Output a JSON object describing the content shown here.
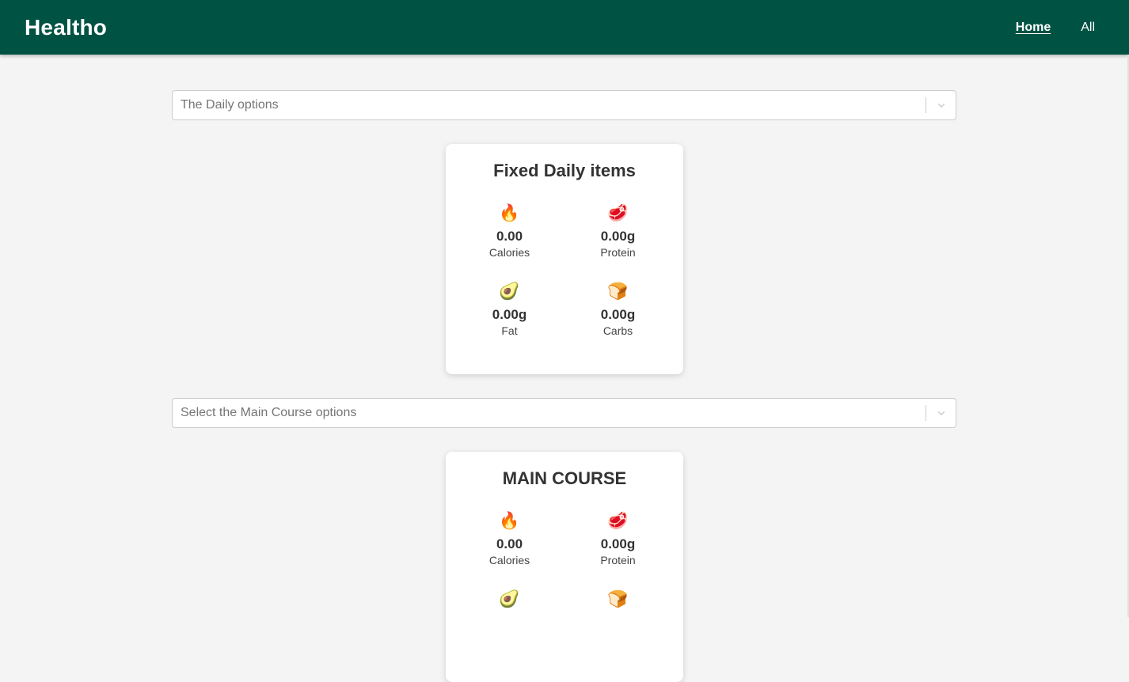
{
  "nav": {
    "brand": "Healtho",
    "links": [
      {
        "label": "Home",
        "active": true
      },
      {
        "label": "All",
        "active": false
      }
    ],
    "color": "#005243"
  },
  "daily": {
    "select_placeholder": "The Daily options",
    "card_title": "Fixed Daily items",
    "stats": [
      {
        "icon": "fire-icon",
        "emoji": "🔥",
        "value": "0.00",
        "label": "Calories"
      },
      {
        "icon": "meat-icon",
        "emoji": "🥩",
        "value": "0.00g",
        "label": "Protein"
      },
      {
        "icon": "avocado-icon",
        "emoji": "🥑",
        "value": "0.00g",
        "label": "Fat"
      },
      {
        "icon": "bread-icon",
        "emoji": "🍞",
        "value": "0.00g",
        "label": "Carbs"
      }
    ]
  },
  "main_course": {
    "select_placeholder": "Select the Main Course options",
    "card_title": "MAIN COURSE",
    "stats": [
      {
        "icon": "fire-icon",
        "emoji": "🔥",
        "value": "0.00",
        "label": "Calories"
      },
      {
        "icon": "meat-icon",
        "emoji": "🥩",
        "value": "0.00g",
        "label": "Protein"
      },
      {
        "icon": "avocado-icon",
        "emoji": "🥑",
        "value": "",
        "label": ""
      },
      {
        "icon": "bread-icon",
        "emoji": "🍞",
        "value": "",
        "label": ""
      }
    ]
  }
}
